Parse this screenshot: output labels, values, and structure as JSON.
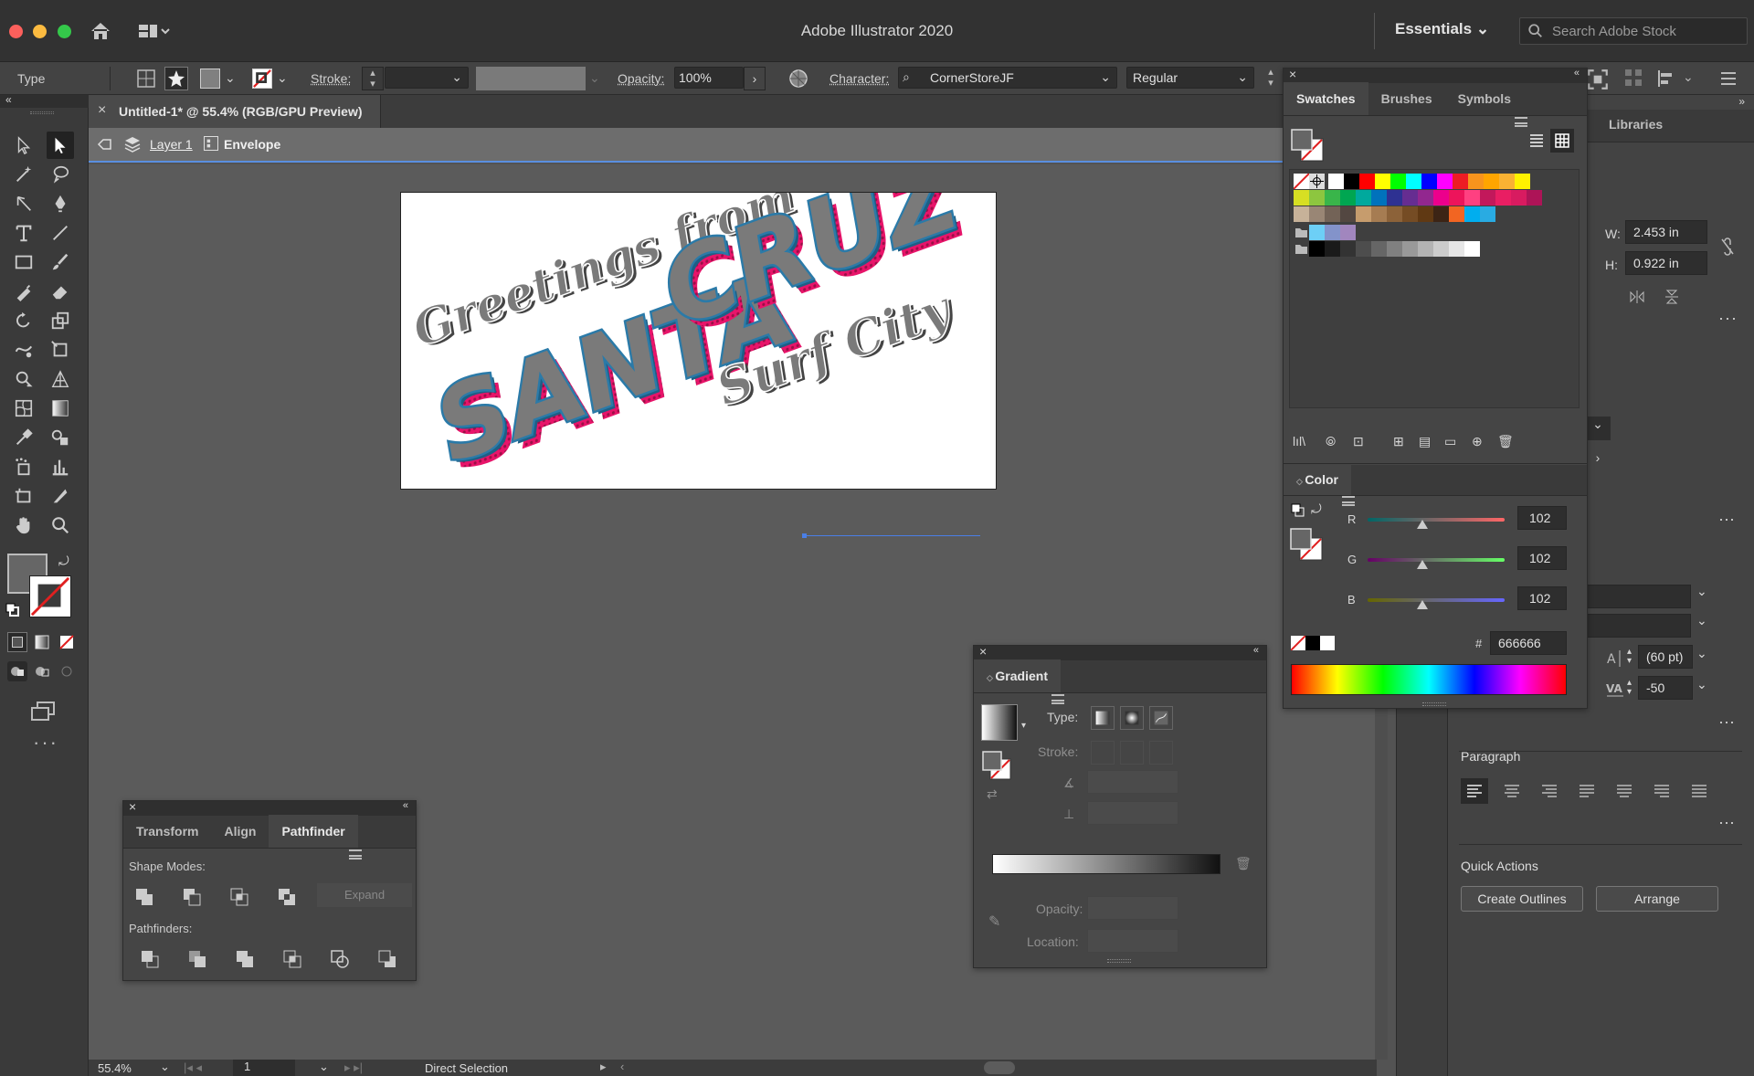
{
  "app": {
    "title": "Adobe Illustrator 2020",
    "workspace": "Essentials",
    "search_placeholder": "Search Adobe Stock"
  },
  "control_bar": {
    "selection_type": "Type",
    "stroke_label": "Stroke:",
    "opacity_label": "Opacity:",
    "opacity_value": "100%",
    "character_label": "Character:",
    "font_family": "CornerStoreJF",
    "font_style": "Regular"
  },
  "document": {
    "tab_title": "Untitled-1* @ 55.4% (RGB/GPU Preview)",
    "isolation_layer": "Layer 1",
    "isolation_object": "Envelope"
  },
  "artwork": {
    "line1": "Greetings from",
    "line2a": "SANTA",
    "line2b": "CRUZ",
    "line3": "Surf City",
    "colors": {
      "blue": "#2b7aa8",
      "gray": "#7a7a7a",
      "pink": "#e8146a"
    }
  },
  "status": {
    "zoom": "55.4%",
    "artboard": "1",
    "tool": "Direct Selection"
  },
  "swatches_panel": {
    "tabs": [
      "Swatches",
      "Brushes",
      "Symbols"
    ],
    "row1": [
      "#ffffff",
      "#000000",
      "#ff0000",
      "#ffff00",
      "#00ff00",
      "#00ffff",
      "#0000ff",
      "#ff00ff",
      "#ed1c24",
      "#f7941d",
      "#ffa500",
      "#f9b233",
      "#fff200"
    ],
    "row2": [
      "#d7df23",
      "#8dc63f",
      "#39b54a",
      "#00a651",
      "#00a99d",
      "#0072bc",
      "#2e3192",
      "#662d91",
      "#92278f",
      "#ec008c",
      "#ed145b",
      "#ff4081",
      "#c2185b",
      "#e91e63",
      "#d81b60",
      "#ad1457"
    ],
    "row3": [
      "#c7b299",
      "#998675",
      "#736357",
      "#534741",
      "#c69c6d",
      "#a67c52",
      "#8c6239",
      "#754c24",
      "#603913",
      "#3c2415",
      "#f26522",
      "#00aeef",
      "#29abe2"
    ],
    "group1": [
      "#6dcff6",
      "#8393ca",
      "#a186be"
    ],
    "group2": [
      "#000000",
      "#1a1a1a",
      "#333333",
      "#4d4d4d",
      "#666666",
      "#808080",
      "#999999",
      "#b3b3b3",
      "#cccccc",
      "#e6e6e6",
      "#ffffff"
    ]
  },
  "color_panel": {
    "title": "Color",
    "r_label": "R",
    "r_value": "102",
    "g_label": "G",
    "g_value": "102",
    "b_label": "B",
    "b_value": "102",
    "hash": "#",
    "hex": "666666"
  },
  "right_panel": {
    "libraries_tab": "Libraries",
    "w_label": "W:",
    "w_value": "2.453 in",
    "h_label": "H:",
    "h_value": "0.922 in",
    "leading": "(60 pt)",
    "tracking": "-50",
    "paragraph_label": "Paragraph",
    "quick_actions_label": "Quick Actions",
    "create_outlines": "Create Outlines",
    "arrange": "Arrange"
  },
  "gradient_panel": {
    "title": "Gradient",
    "type_label": "Type:",
    "stroke_label": "Stroke:",
    "opacity_label": "Opacity:",
    "location_label": "Location:"
  },
  "pathfinder_panel": {
    "tabs": [
      "Transform",
      "Align",
      "Pathfinder"
    ],
    "shape_modes": "Shape Modes:",
    "expand": "Expand",
    "pathfinders": "Pathfinders:"
  }
}
